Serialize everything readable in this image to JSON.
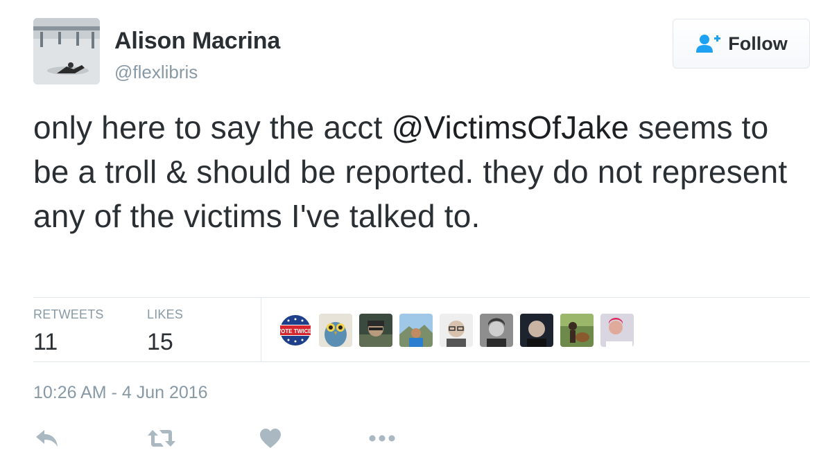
{
  "author": {
    "display_name": "Alison Macrina",
    "handle": "@flexlibris",
    "avatar_icon": "user-avatar-photo"
  },
  "follow_button": {
    "label": "Follow",
    "icon": "add-user-icon",
    "accent": "#1da1f2"
  },
  "tweet": {
    "text_before": "only here to say the acct ",
    "mention": "@VictimsOfJake",
    "text_after": " seems to be a troll & should be reported. they do not represent any of the victims I've talked to."
  },
  "stats": {
    "retweets_label": "RETWEETS",
    "retweets_value": "11",
    "likes_label": "LIKES",
    "likes_value": "15"
  },
  "likers": {
    "vote_badge_top": "VOTE TWICE!"
  },
  "timestamp": "10:26 AM - 4 Jun 2016",
  "actions": [
    "reply-icon",
    "retweet-icon",
    "like-icon",
    "more-icon"
  ],
  "colors": {
    "text": "#292f33",
    "muted": "#8899a6",
    "border": "#e1e8ed",
    "icon": "#aab8c2"
  }
}
